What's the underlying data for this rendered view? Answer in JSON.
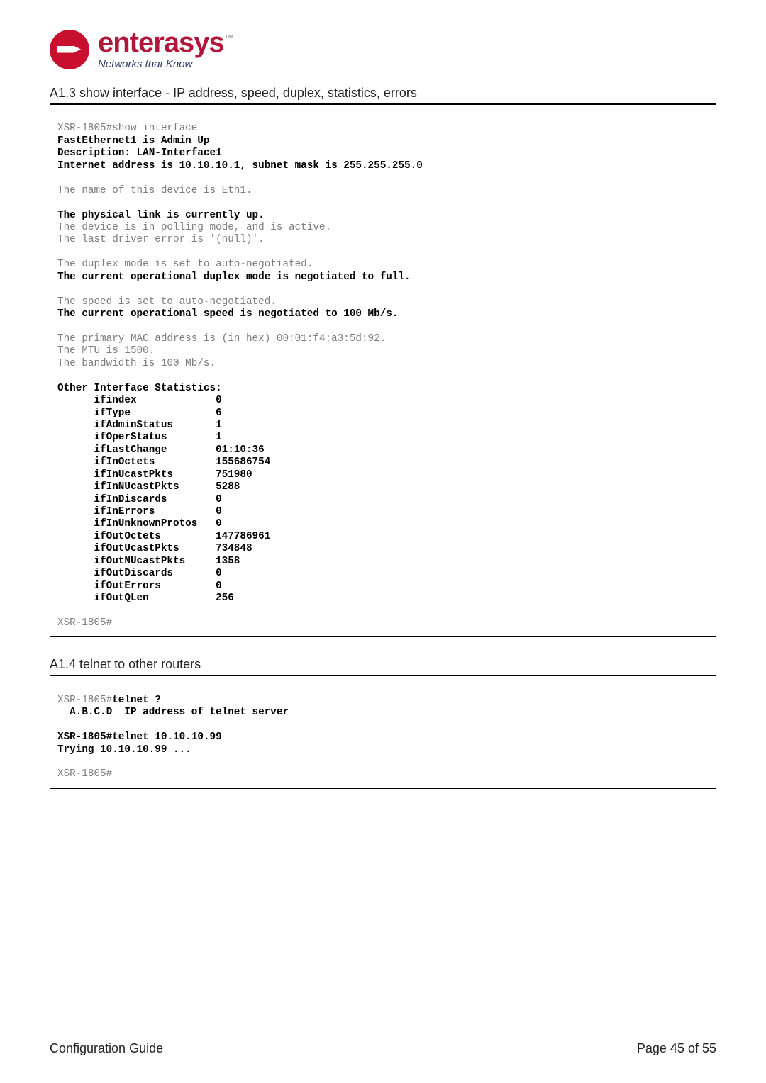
{
  "logo": {
    "name": "enterasys",
    "tm": "™",
    "tagline": "Networks that Know"
  },
  "section1": {
    "heading": "A1.3 show interface - IP address, speed, duplex, statistics, errors",
    "lines": [
      {
        "b": false,
        "t": ""
      },
      {
        "b": false,
        "t": "XSR-1805#show interface"
      },
      {
        "b": true,
        "t": "FastEthernet1 is Admin Up"
      },
      {
        "b": true,
        "t": "Description: LAN-Interface1"
      },
      {
        "b": true,
        "t": "Internet address is 10.10.10.1, subnet mask is 255.255.255.0"
      },
      {
        "b": false,
        "t": ""
      },
      {
        "b": false,
        "t": "The name of this device is Eth1."
      },
      {
        "b": false,
        "t": ""
      },
      {
        "b": true,
        "t": "The physical link is currently up."
      },
      {
        "b": false,
        "t": "The device is in polling mode, and is active."
      },
      {
        "b": false,
        "t": "The last driver error is '(null)'."
      },
      {
        "b": false,
        "t": ""
      },
      {
        "b": false,
        "t": "The duplex mode is set to auto-negotiated."
      },
      {
        "b": true,
        "t": "The current operational duplex mode is negotiated to full."
      },
      {
        "b": false,
        "t": ""
      },
      {
        "b": false,
        "t": "The speed is set to auto-negotiated."
      },
      {
        "b": true,
        "t": "The current operational speed is negotiated to 100 Mb/s."
      },
      {
        "b": false,
        "t": ""
      },
      {
        "b": false,
        "t": "The primary MAC address is (in hex) 00:01:f4:a3:5d:92."
      },
      {
        "b": false,
        "t": "The MTU is 1500."
      },
      {
        "b": false,
        "t": "The bandwidth is 100 Mb/s."
      },
      {
        "b": false,
        "t": ""
      },
      {
        "b": true,
        "t": "Other Interface Statistics:"
      },
      {
        "b": true,
        "t": "      ifindex             0"
      },
      {
        "b": true,
        "t": "      ifType              6"
      },
      {
        "b": true,
        "t": "      ifAdminStatus       1"
      },
      {
        "b": true,
        "t": "      ifOperStatus        1"
      },
      {
        "b": true,
        "t": "      ifLastChange        01:10:36"
      },
      {
        "b": true,
        "t": "      ifInOctets          155686754"
      },
      {
        "b": true,
        "t": "      ifInUcastPkts       751980"
      },
      {
        "b": true,
        "t": "      ifInNUcastPkts      5288"
      },
      {
        "b": true,
        "t": "      ifInDiscards        0"
      },
      {
        "b": true,
        "t": "      ifInErrors          0"
      },
      {
        "b": true,
        "t": "      ifInUnknownProtos   0"
      },
      {
        "b": true,
        "t": "      ifOutOctets         147786961"
      },
      {
        "b": true,
        "t": "      ifOutUcastPkts      734848"
      },
      {
        "b": true,
        "t": "      ifOutNUcastPkts     1358"
      },
      {
        "b": true,
        "t": "      ifOutDiscards       0"
      },
      {
        "b": true,
        "t": "      ifOutErrors         0"
      },
      {
        "b": true,
        "t": "      ifOutQLen           256"
      },
      {
        "b": false,
        "t": ""
      },
      {
        "b": false,
        "t": "XSR-1805#"
      }
    ]
  },
  "section2": {
    "heading": "A1.4 telnet to other routers",
    "prefix": "XSR-1805#",
    "lines_after_prefix": [
      {
        "b": true,
        "t": "telnet ?"
      },
      {
        "b": true,
        "t": "  A.B.C.D  IP address of telnet server"
      },
      {
        "b": false,
        "t": ""
      },
      {
        "b": true,
        "t": "XSR-1805#telnet 10.10.10.99"
      },
      {
        "b": true,
        "t": "Trying 10.10.10.99 ..."
      },
      {
        "b": false,
        "t": ""
      },
      {
        "b": false,
        "t": "XSR-1805#"
      }
    ]
  },
  "footer": {
    "left": "Configuration Guide",
    "right": "Page 45 of 55"
  }
}
